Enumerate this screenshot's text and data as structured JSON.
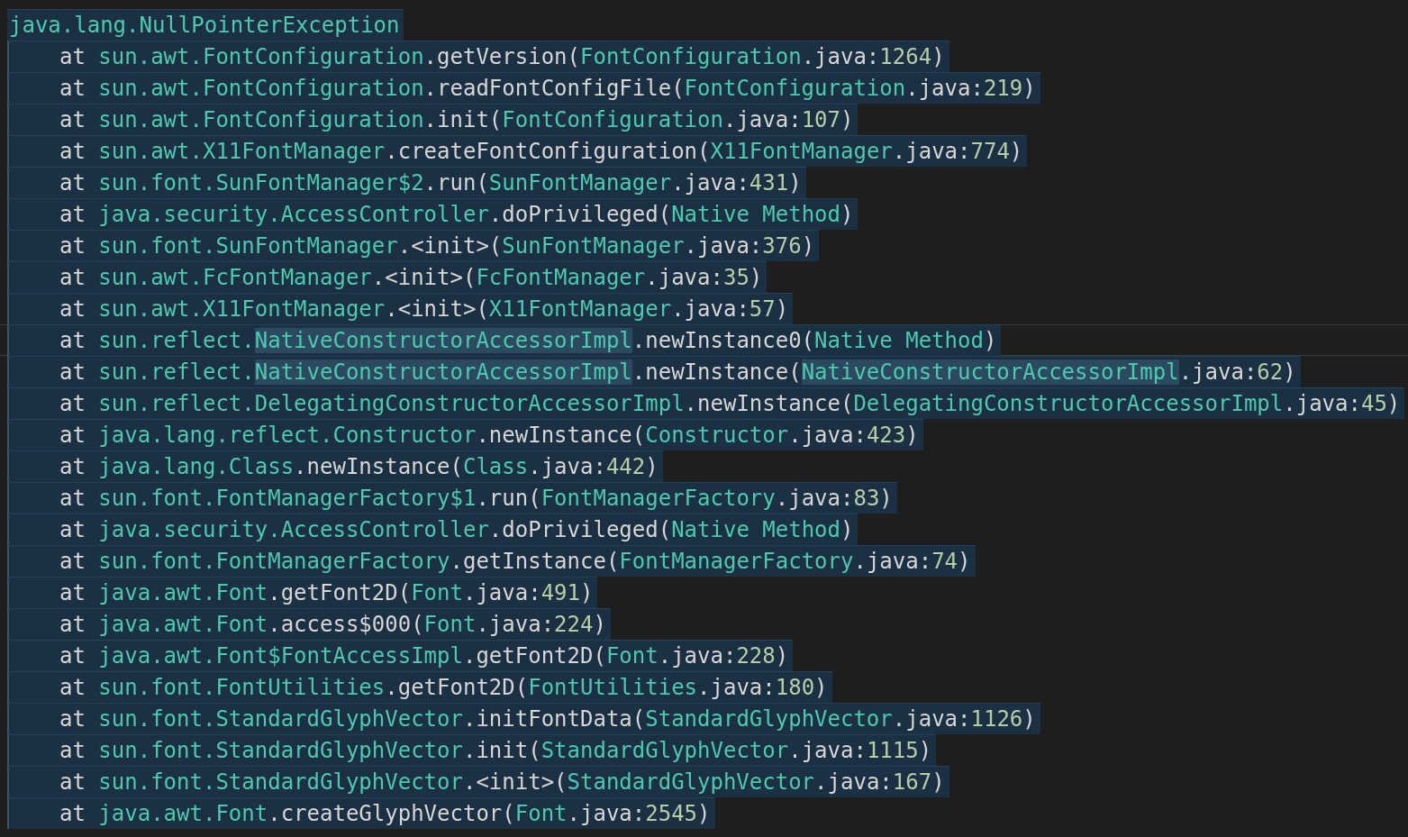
{
  "editor": {
    "exception": {
      "selected": true,
      "tokens": [
        {
          "text": "java.lang.NullPointerException",
          "kind": "type"
        }
      ]
    },
    "frames": [
      {
        "current": false,
        "selected": true,
        "tokens": [
          {
            "text": "at ",
            "kind": "plain"
          },
          {
            "text": "sun.awt.FontConfiguration",
            "kind": "type"
          },
          {
            "text": ".getVersion(",
            "kind": "plain"
          },
          {
            "text": "FontConfiguration",
            "kind": "type"
          },
          {
            "text": ".java:",
            "kind": "plain"
          },
          {
            "text": "1264",
            "kind": "number"
          },
          {
            "text": ")",
            "kind": "plain"
          }
        ]
      },
      {
        "current": false,
        "selected": true,
        "tokens": [
          {
            "text": "at ",
            "kind": "plain"
          },
          {
            "text": "sun.awt.FontConfiguration",
            "kind": "type"
          },
          {
            "text": ".readFontConfigFile(",
            "kind": "plain"
          },
          {
            "text": "FontConfiguration",
            "kind": "type"
          },
          {
            "text": ".java:",
            "kind": "plain"
          },
          {
            "text": "219",
            "kind": "number"
          },
          {
            "text": ")",
            "kind": "plain"
          }
        ]
      },
      {
        "current": false,
        "selected": true,
        "tokens": [
          {
            "text": "at ",
            "kind": "plain"
          },
          {
            "text": "sun.awt.FontConfiguration",
            "kind": "type"
          },
          {
            "text": ".init(",
            "kind": "plain"
          },
          {
            "text": "FontConfiguration",
            "kind": "type"
          },
          {
            "text": ".java:",
            "kind": "plain"
          },
          {
            "text": "107",
            "kind": "number"
          },
          {
            "text": ")",
            "kind": "plain"
          }
        ]
      },
      {
        "current": false,
        "selected": true,
        "tokens": [
          {
            "text": "at ",
            "kind": "plain"
          },
          {
            "text": "sun.awt.X11FontManager",
            "kind": "type"
          },
          {
            "text": ".createFontConfiguration(",
            "kind": "plain"
          },
          {
            "text": "X11FontManager",
            "kind": "type"
          },
          {
            "text": ".java:",
            "kind": "plain"
          },
          {
            "text": "774",
            "kind": "number"
          },
          {
            "text": ")",
            "kind": "plain"
          }
        ]
      },
      {
        "current": false,
        "selected": true,
        "tokens": [
          {
            "text": "at ",
            "kind": "plain"
          },
          {
            "text": "sun.font.SunFontManager$2",
            "kind": "type"
          },
          {
            "text": ".run(",
            "kind": "plain"
          },
          {
            "text": "SunFontManager",
            "kind": "type"
          },
          {
            "text": ".java:",
            "kind": "plain"
          },
          {
            "text": "431",
            "kind": "number"
          },
          {
            "text": ")",
            "kind": "plain"
          }
        ]
      },
      {
        "current": false,
        "selected": true,
        "tokens": [
          {
            "text": "at ",
            "kind": "plain"
          },
          {
            "text": "java.security.AccessController",
            "kind": "type"
          },
          {
            "text": ".doPrivileged(",
            "kind": "plain"
          },
          {
            "text": "Native Method",
            "kind": "type"
          },
          {
            "text": ")",
            "kind": "plain"
          }
        ]
      },
      {
        "current": false,
        "selected": true,
        "tokens": [
          {
            "text": "at ",
            "kind": "plain"
          },
          {
            "text": "sun.font.SunFontManager",
            "kind": "type"
          },
          {
            "text": ".<init>(",
            "kind": "plain"
          },
          {
            "text": "SunFontManager",
            "kind": "type"
          },
          {
            "text": ".java:",
            "kind": "plain"
          },
          {
            "text": "376",
            "kind": "number"
          },
          {
            "text": ")",
            "kind": "plain"
          }
        ]
      },
      {
        "current": false,
        "selected": true,
        "tokens": [
          {
            "text": "at ",
            "kind": "plain"
          },
          {
            "text": "sun.awt.FcFontManager",
            "kind": "type"
          },
          {
            "text": ".<init>(",
            "kind": "plain"
          },
          {
            "text": "FcFontManager",
            "kind": "type"
          },
          {
            "text": ".java:",
            "kind": "plain"
          },
          {
            "text": "35",
            "kind": "number"
          },
          {
            "text": ")",
            "kind": "plain"
          }
        ]
      },
      {
        "current": false,
        "selected": true,
        "tokens": [
          {
            "text": "at ",
            "kind": "plain"
          },
          {
            "text": "sun.awt.X11FontManager",
            "kind": "type"
          },
          {
            "text": ".<init>(",
            "kind": "plain"
          },
          {
            "text": "X11FontManager",
            "kind": "type"
          },
          {
            "text": ".java:",
            "kind": "plain"
          },
          {
            "text": "57",
            "kind": "number"
          },
          {
            "text": ")",
            "kind": "plain"
          }
        ]
      },
      {
        "current": true,
        "selected": true,
        "tokens": [
          {
            "text": "at ",
            "kind": "plain"
          },
          {
            "text": "sun.reflect.",
            "kind": "type"
          },
          {
            "text": "NativeConstructorAccessorImpl",
            "kind": "type-match"
          },
          {
            "text": ".newInstance0(",
            "kind": "plain"
          },
          {
            "text": "Native Method",
            "kind": "type"
          },
          {
            "text": ")",
            "kind": "plain"
          }
        ]
      },
      {
        "current": false,
        "selected": true,
        "tokens": [
          {
            "text": "at ",
            "kind": "plain"
          },
          {
            "text": "sun.reflect.",
            "kind": "type"
          },
          {
            "text": "NativeConstructorAccessorImpl",
            "kind": "type-match"
          },
          {
            "text": ".newInstance(",
            "kind": "plain"
          },
          {
            "text": "NativeConstructorAccessorImpl",
            "kind": "type-match"
          },
          {
            "text": ".java:",
            "kind": "plain"
          },
          {
            "text": "62",
            "kind": "number"
          },
          {
            "text": ")",
            "kind": "plain"
          }
        ]
      },
      {
        "current": false,
        "selected": true,
        "tokens": [
          {
            "text": "at ",
            "kind": "plain"
          },
          {
            "text": "sun.reflect.DelegatingConstructorAccessorImpl",
            "kind": "type"
          },
          {
            "text": ".newInstance(",
            "kind": "plain"
          },
          {
            "text": "DelegatingConstructorAccessorImpl",
            "kind": "type"
          },
          {
            "text": ".java:",
            "kind": "plain"
          },
          {
            "text": "45",
            "kind": "number"
          },
          {
            "text": ")",
            "kind": "plain"
          }
        ]
      },
      {
        "current": false,
        "selected": true,
        "tokens": [
          {
            "text": "at ",
            "kind": "plain"
          },
          {
            "text": "java.lang.reflect.Constructor",
            "kind": "type"
          },
          {
            "text": ".newInstance(",
            "kind": "plain"
          },
          {
            "text": "Constructor",
            "kind": "type"
          },
          {
            "text": ".java:",
            "kind": "plain"
          },
          {
            "text": "423",
            "kind": "number"
          },
          {
            "text": ")",
            "kind": "plain"
          }
        ]
      },
      {
        "current": false,
        "selected": true,
        "tokens": [
          {
            "text": "at ",
            "kind": "plain"
          },
          {
            "text": "java.lang.Class",
            "kind": "type"
          },
          {
            "text": ".newInstance(",
            "kind": "plain"
          },
          {
            "text": "Class",
            "kind": "type"
          },
          {
            "text": ".java:",
            "kind": "plain"
          },
          {
            "text": "442",
            "kind": "number"
          },
          {
            "text": ")",
            "kind": "plain"
          }
        ]
      },
      {
        "current": false,
        "selected": true,
        "tokens": [
          {
            "text": "at ",
            "kind": "plain"
          },
          {
            "text": "sun.font.FontManagerFactory$1",
            "kind": "type"
          },
          {
            "text": ".run(",
            "kind": "plain"
          },
          {
            "text": "FontManagerFactory",
            "kind": "type"
          },
          {
            "text": ".java:",
            "kind": "plain"
          },
          {
            "text": "83",
            "kind": "number"
          },
          {
            "text": ")",
            "kind": "plain"
          }
        ]
      },
      {
        "current": false,
        "selected": true,
        "tokens": [
          {
            "text": "at ",
            "kind": "plain"
          },
          {
            "text": "java.security.AccessController",
            "kind": "type"
          },
          {
            "text": ".doPrivileged(",
            "kind": "plain"
          },
          {
            "text": "Native Method",
            "kind": "type"
          },
          {
            "text": ")",
            "kind": "plain"
          }
        ]
      },
      {
        "current": false,
        "selected": true,
        "tokens": [
          {
            "text": "at ",
            "kind": "plain"
          },
          {
            "text": "sun.font.FontManagerFactory",
            "kind": "type"
          },
          {
            "text": ".getInstance(",
            "kind": "plain"
          },
          {
            "text": "FontManagerFactory",
            "kind": "type"
          },
          {
            "text": ".java:",
            "kind": "plain"
          },
          {
            "text": "74",
            "kind": "number"
          },
          {
            "text": ")",
            "kind": "plain"
          }
        ]
      },
      {
        "current": false,
        "selected": true,
        "tokens": [
          {
            "text": "at ",
            "kind": "plain"
          },
          {
            "text": "java.awt.Font",
            "kind": "type"
          },
          {
            "text": ".getFont2D(",
            "kind": "plain"
          },
          {
            "text": "Font",
            "kind": "type"
          },
          {
            "text": ".java:",
            "kind": "plain"
          },
          {
            "text": "491",
            "kind": "number"
          },
          {
            "text": ")",
            "kind": "plain"
          }
        ]
      },
      {
        "current": false,
        "selected": true,
        "tokens": [
          {
            "text": "at ",
            "kind": "plain"
          },
          {
            "text": "java.awt.Font",
            "kind": "type"
          },
          {
            "text": ".access$000(",
            "kind": "plain"
          },
          {
            "text": "Font",
            "kind": "type"
          },
          {
            "text": ".java:",
            "kind": "plain"
          },
          {
            "text": "224",
            "kind": "number"
          },
          {
            "text": ")",
            "kind": "plain"
          }
        ]
      },
      {
        "current": false,
        "selected": true,
        "tokens": [
          {
            "text": "at ",
            "kind": "plain"
          },
          {
            "text": "java.awt.Font$FontAccessImpl",
            "kind": "type"
          },
          {
            "text": ".getFont2D(",
            "kind": "plain"
          },
          {
            "text": "Font",
            "kind": "type"
          },
          {
            "text": ".java:",
            "kind": "plain"
          },
          {
            "text": "228",
            "kind": "number"
          },
          {
            "text": ")",
            "kind": "plain"
          }
        ]
      },
      {
        "current": false,
        "selected": true,
        "tokens": [
          {
            "text": "at ",
            "kind": "plain"
          },
          {
            "text": "sun.font.FontUtilities",
            "kind": "type"
          },
          {
            "text": ".getFont2D(",
            "kind": "plain"
          },
          {
            "text": "FontUtilities",
            "kind": "type"
          },
          {
            "text": ".java:",
            "kind": "plain"
          },
          {
            "text": "180",
            "kind": "number"
          },
          {
            "text": ")",
            "kind": "plain"
          }
        ]
      },
      {
        "current": false,
        "selected": true,
        "tokens": [
          {
            "text": "at ",
            "kind": "plain"
          },
          {
            "text": "sun.font.StandardGlyphVector",
            "kind": "type"
          },
          {
            "text": ".initFontData(",
            "kind": "plain"
          },
          {
            "text": "StandardGlyphVector",
            "kind": "type"
          },
          {
            "text": ".java:",
            "kind": "plain"
          },
          {
            "text": "1126",
            "kind": "number"
          },
          {
            "text": ")",
            "kind": "plain"
          }
        ]
      },
      {
        "current": false,
        "selected": true,
        "tokens": [
          {
            "text": "at ",
            "kind": "plain"
          },
          {
            "text": "sun.font.StandardGlyphVector",
            "kind": "type"
          },
          {
            "text": ".init(",
            "kind": "plain"
          },
          {
            "text": "StandardGlyphVector",
            "kind": "type"
          },
          {
            "text": ".java:",
            "kind": "plain"
          },
          {
            "text": "1115",
            "kind": "number"
          },
          {
            "text": ")",
            "kind": "plain"
          }
        ]
      },
      {
        "current": false,
        "selected": true,
        "tokens": [
          {
            "text": "at ",
            "kind": "plain"
          },
          {
            "text": "sun.font.StandardGlyphVector",
            "kind": "type"
          },
          {
            "text": ".<init>(",
            "kind": "plain"
          },
          {
            "text": "StandardGlyphVector",
            "kind": "type"
          },
          {
            "text": ".java:",
            "kind": "plain"
          },
          {
            "text": "167",
            "kind": "number"
          },
          {
            "text": ")",
            "kind": "plain"
          }
        ]
      },
      {
        "current": false,
        "selected": true,
        "tokens": [
          {
            "text": "at ",
            "kind": "plain"
          },
          {
            "text": "java.awt.Font",
            "kind": "type"
          },
          {
            "text": ".createGlyphVector(",
            "kind": "plain"
          },
          {
            "text": "Font",
            "kind": "type"
          },
          {
            "text": ".java:",
            "kind": "plain"
          },
          {
            "text": "2545",
            "kind": "number"
          },
          {
            "text": ")",
            "kind": "plain"
          }
        ]
      }
    ]
  }
}
